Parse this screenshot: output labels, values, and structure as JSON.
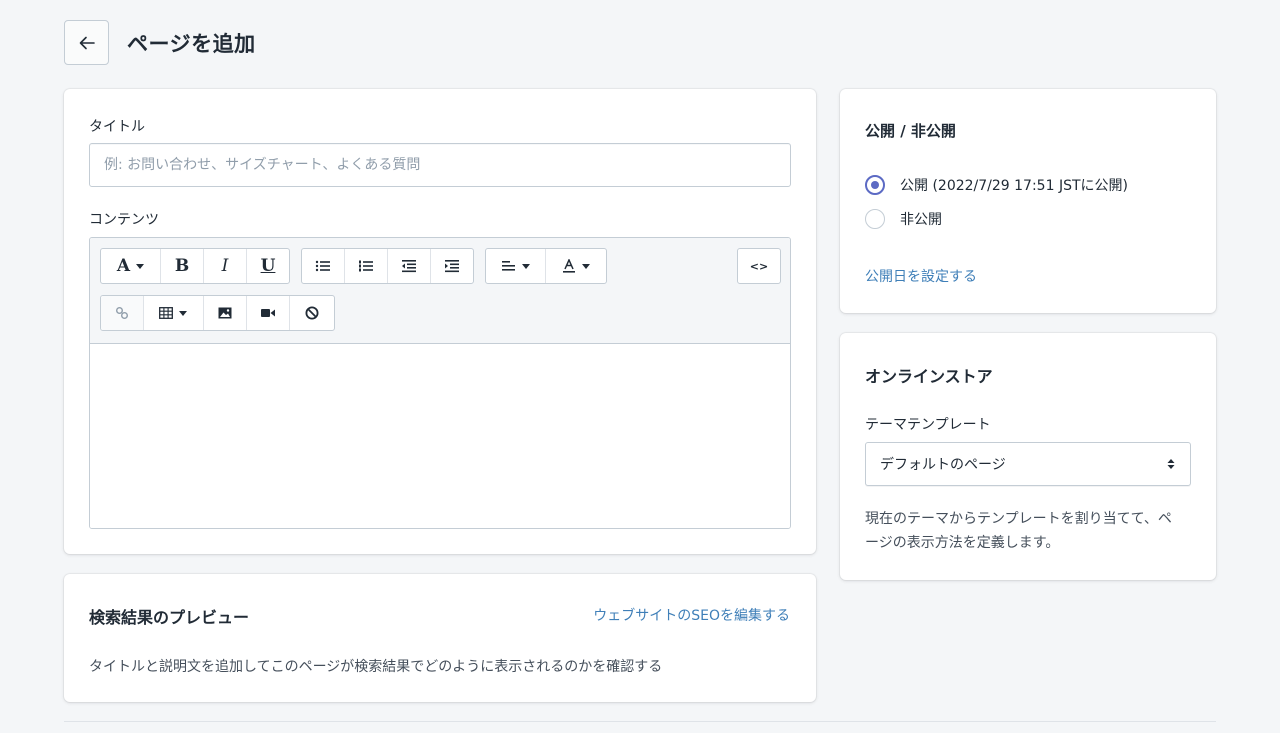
{
  "header": {
    "title": "ページを追加"
  },
  "main": {
    "title_label": "タイトル",
    "title_placeholder": "例: お問い合わせ、サイズチャート、よくある質問",
    "content_label": "コンテンツ",
    "toolbar": {
      "font_label": "A",
      "bold_label": "B",
      "italic_label": "I",
      "underline_label": "U",
      "source_label": "<>"
    }
  },
  "seo": {
    "title": "検索結果のプレビュー",
    "edit_link": "ウェブサイトのSEOを編集する",
    "description": "タイトルと説明文を追加してこのページが検索結果でどのように表示されるのかを確認する"
  },
  "visibility": {
    "title": "公開 / 非公開",
    "options": [
      {
        "label": "公開 (2022/7/29 17:51 JSTに公開)",
        "checked": true
      },
      {
        "label": "非公開",
        "checked": false
      }
    ],
    "set_date_link": "公開日を設定する"
  },
  "online_store": {
    "title": "オンラインストア",
    "template_label": "テーマテンプレート",
    "template_value": "デフォルトのページ",
    "help": "現在のテーマからテンプレートを割り当てて、ページの表示方法を定義します。"
  },
  "colors": {
    "background": "#f4f6f8",
    "accent": "#5c6ac4",
    "link": "#3f7fb8",
    "border": "#c4cdd5"
  }
}
